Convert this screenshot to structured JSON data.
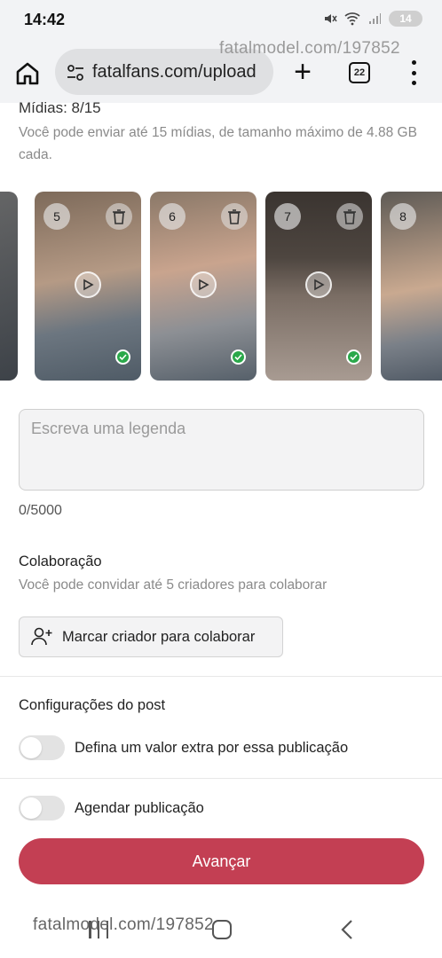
{
  "status_bar": {
    "time": "14:42",
    "battery": "14"
  },
  "browser": {
    "url": "fatalfans.com/upload",
    "tabs_count": "22"
  },
  "watermark": {
    "text": "fatalmodel.com/197852"
  },
  "media": {
    "count_label": "Mídias: 8/15",
    "description": "Você pode enviar até 15 mídias, de tamanho máximo de 4.88 GB cada.",
    "thumbnails": [
      {
        "number": "5",
        "uploaded": true,
        "colors": [
          "#7d6a5a",
          "#b59a85",
          "#4f5b66"
        ]
      },
      {
        "number": "6",
        "uploaded": true,
        "colors": [
          "#8a7868",
          "#c9a48e",
          "#56606a"
        ]
      },
      {
        "number": "7",
        "uploaded": true,
        "colors": [
          "#3a3430",
          "#7a6d64",
          "#a89b92"
        ]
      },
      {
        "number": "8",
        "uploaded": false,
        "colors": [
          "#5e5a55",
          "#c9a990",
          "#4a5460"
        ]
      }
    ]
  },
  "caption": {
    "placeholder": "Escreva uma legenda",
    "value": "",
    "char_count": "0/5000"
  },
  "collaboration": {
    "title": "Colaboração",
    "description": "Você pode convidar até 5 criadores para colaborar",
    "button_label": "Marcar criador para colaborar"
  },
  "post_settings": {
    "title": "Configurações do post",
    "extra_value_label": "Defina um valor extra por essa publicação",
    "extra_value_on": false,
    "schedule_label": "Agendar publicação",
    "schedule_on": false
  },
  "next_button": {
    "label": "Avançar"
  },
  "colors": {
    "primary": "#c33f53",
    "check": "#2aa84a"
  }
}
